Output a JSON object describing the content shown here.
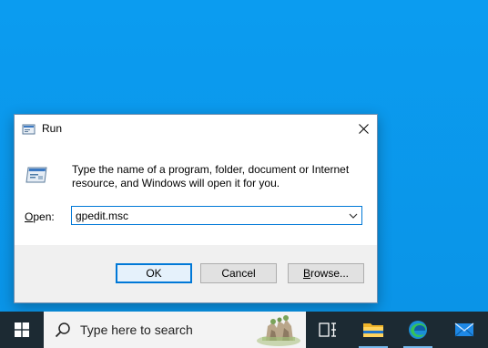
{
  "dialog": {
    "title": "Run",
    "description": "Type the name of a program, folder, document or Internet resource, and Windows will open it for you.",
    "open_label_prefix": "O",
    "open_label_rest": "pen:",
    "open_value": "gpedit.msc",
    "ok_label": "OK",
    "cancel_label": "Cancel",
    "browse_label_prefix": "B",
    "browse_label_rest": "rowse..."
  },
  "taskbar": {
    "search_placeholder": "Type here to search",
    "icons": [
      "windows-start-icon",
      "search-icon",
      "task-view-icon",
      "file-explorer-icon",
      "edge-icon",
      "mail-icon"
    ]
  },
  "colors": {
    "desktop": "#0a94e8",
    "taskbar": "#1c2a33",
    "accent": "#0078d7"
  }
}
